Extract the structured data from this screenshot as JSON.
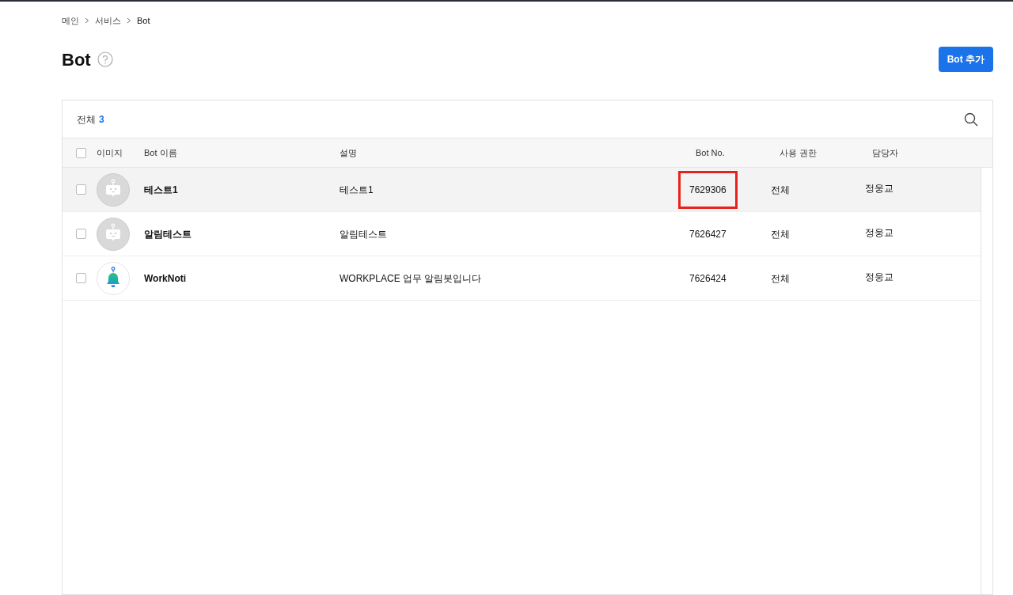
{
  "breadcrumb": [
    "메인",
    "서비스",
    "Bot"
  ],
  "page_title": "Bot",
  "add_button": "Bot 추가",
  "total": {
    "label": "전체",
    "count": "3"
  },
  "table": {
    "select_all_checked": false,
    "columns": [
      "이미지",
      "Bot 이름",
      "설명",
      "Bot No.",
      "사용 권한",
      "담당자"
    ],
    "rows": [
      {
        "checked": false,
        "selected": true,
        "kind": "robot",
        "name": "테스트1",
        "description": "테스트1",
        "bot_no": "7629306",
        "bot_no_boxed": true,
        "permission": "전체",
        "manager": "정웅교"
      },
      {
        "checked": false,
        "selected": false,
        "kind": "robot",
        "name": "알림테스트",
        "description": "알림테스트",
        "bot_no": "7626427",
        "bot_no_boxed": false,
        "permission": "전체",
        "manager": "정웅교"
      },
      {
        "checked": false,
        "selected": false,
        "kind": "bell",
        "name": "WorkNoti",
        "description": "WORKPLACE 업무 알림봇입니다",
        "bot_no": "7626424",
        "bot_no_boxed": false,
        "permission": "전체",
        "manager": "정웅교"
      }
    ]
  }
}
